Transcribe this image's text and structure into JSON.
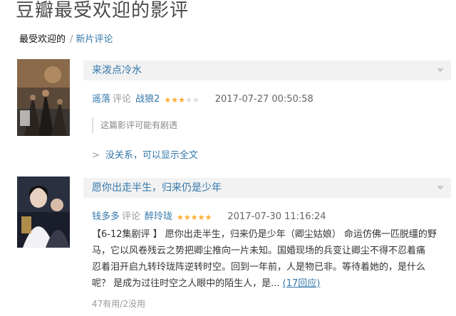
{
  "page": {
    "title": "豆瓣最受欢迎的影评"
  },
  "breadcrumb": {
    "current": "最受欢迎的",
    "separator": "/",
    "link": "新片评论"
  },
  "reviews": [
    {
      "poster_icon": "movie-poster-wolf-warrior-2",
      "title": "来泼点冷水",
      "user": "遥落",
      "action": "评论",
      "movie": "战狼2",
      "rating": 3,
      "rating_max": 5,
      "time": "2017-07-27 00:50:58",
      "spoiler_notice": "这篇影评可能有剧透",
      "show_full_arrow": ">",
      "show_full": "没关系，可以显示全文"
    },
    {
      "poster_icon": "movie-poster-zui-ling-long",
      "title": "愿你出走半生，归来仍是少年",
      "user": "钱多多",
      "action": "评论",
      "movie": "醉玲珑",
      "rating": 5,
      "rating_max": 5,
      "time": "2017-07-30 11:16:24",
      "excerpt_lines": [
        "【6-12集剧评 】 愿你出走半生，归来仍是少年（卿尘姑娘） 命运仿佛一匹脱缰的野",
        "马，它以风卷残云之势把卿尘推向一片未知。国婚现场的兵变让卿尘不得不忍着痛",
        "忍着泪开启九转玲珑阵逆转时空。回到一年前，人是物已非。等待着她的，是什么",
        "呢？ 是成为过往时空之人眼中的陌生人，是..."
      ],
      "reply_count": "(17回应)",
      "useful": "47有用",
      "vote_separator": "/",
      "useless": "2没用"
    }
  ],
  "colors": {
    "link": "#3377aa",
    "star": "#ffac2d",
    "bar_bg": "#f2f2f2"
  }
}
